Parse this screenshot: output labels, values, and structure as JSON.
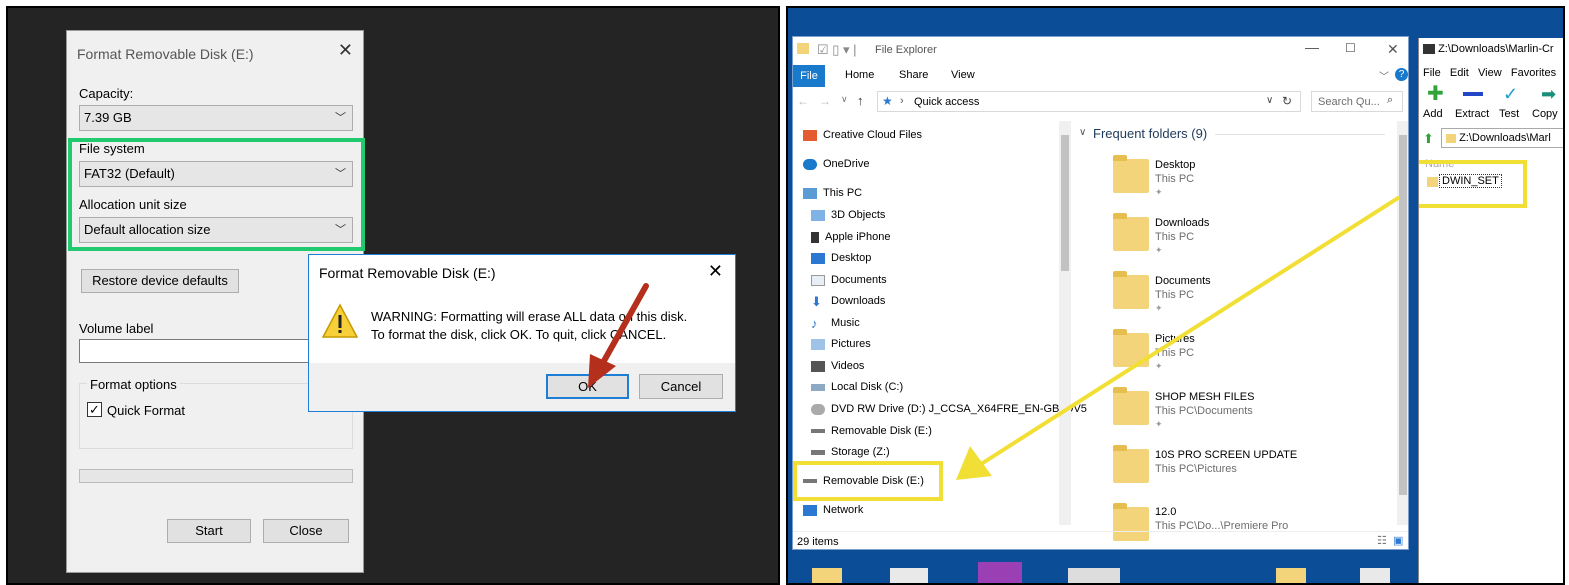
{
  "format_dialog": {
    "title": "Format Removable Disk (E:)",
    "capacity_label": "Capacity:",
    "capacity_value": "7.39 GB",
    "filesystem_label": "File system",
    "filesystem_value": "FAT32 (Default)",
    "alloc_label": "Allocation unit size",
    "alloc_value": "Default allocation size",
    "restore_button": "Restore device defaults",
    "volume_label": "Volume label",
    "volume_value": "",
    "options_label": "Format options",
    "quick_format_label": "Quick Format",
    "quick_format_checked": true,
    "start_button": "Start",
    "close_button": "Close"
  },
  "warning_dialog": {
    "title": "Format Removable Disk (E:)",
    "line1": "WARNING: Formatting will erase ALL data on this disk.",
    "line2": "To format the disk, click OK. To quit, click CANCEL.",
    "ok_button": "OK",
    "cancel_button": "Cancel"
  },
  "explorer": {
    "title": "File Explorer",
    "tabs": [
      "File",
      "Home",
      "Share",
      "View"
    ],
    "address": "Quick access",
    "search_placeholder": "Search Qu...",
    "nav_items": [
      {
        "label": "Creative Cloud Files",
        "icon": "creative-cloud-icon"
      },
      {
        "label": "OneDrive",
        "icon": "onedrive-icon"
      },
      {
        "label": "This PC",
        "icon": "computer-icon"
      },
      {
        "label": "3D Objects",
        "icon": "cube-icon"
      },
      {
        "label": "Apple iPhone",
        "icon": "phone-icon"
      },
      {
        "label": "Desktop",
        "icon": "desktop-icon"
      },
      {
        "label": "Documents",
        "icon": "document-icon"
      },
      {
        "label": "Downloads",
        "icon": "download-icon"
      },
      {
        "label": "Music",
        "icon": "music-icon"
      },
      {
        "label": "Pictures",
        "icon": "picture-icon"
      },
      {
        "label": "Videos",
        "icon": "video-icon"
      },
      {
        "label": "Local Disk (C:)",
        "icon": "drive-icon"
      },
      {
        "label": "DVD RW Drive (D:) J_CCSA_X64FRE_EN-GB_DV5",
        "icon": "dvd-icon"
      },
      {
        "label": "Removable Disk (E:)",
        "icon": "usb-drive-icon"
      },
      {
        "label": "Storage (Z:)",
        "icon": "network-drive-icon"
      },
      {
        "label": "Removable Disk (E:)",
        "icon": "usb-drive-icon"
      },
      {
        "label": "Network",
        "icon": "network-icon"
      }
    ],
    "section_title": "Frequent folders (9)",
    "folders": [
      {
        "name": "Desktop",
        "sub": "This PC"
      },
      {
        "name": "Downloads",
        "sub": "This PC"
      },
      {
        "name": "Documents",
        "sub": "This PC"
      },
      {
        "name": "Pictures",
        "sub": "This PC"
      },
      {
        "name": "SHOP MESH FILES",
        "sub": "This PC\\Documents"
      },
      {
        "name": "10S PRO SCREEN UPDATE",
        "sub": "This PC\\Pictures"
      },
      {
        "name": "12.0",
        "sub": "This PC\\Do...\\Premiere Pro"
      }
    ],
    "status": "29 items"
  },
  "winrar": {
    "title": "Z:\\Downloads\\Marlin-Cr",
    "menu": [
      "File",
      "Edit",
      "View",
      "Favorites"
    ],
    "tools": [
      "Add",
      "Extract",
      "Test",
      "Copy"
    ],
    "path": "Z:\\Downloads\\Marl",
    "column": "Name",
    "item": "DWIN_SET"
  },
  "colors": {
    "highlight_green": "#21c96f",
    "highlight_yellow": "#f1df35",
    "arrow_red": "#b5301c"
  }
}
